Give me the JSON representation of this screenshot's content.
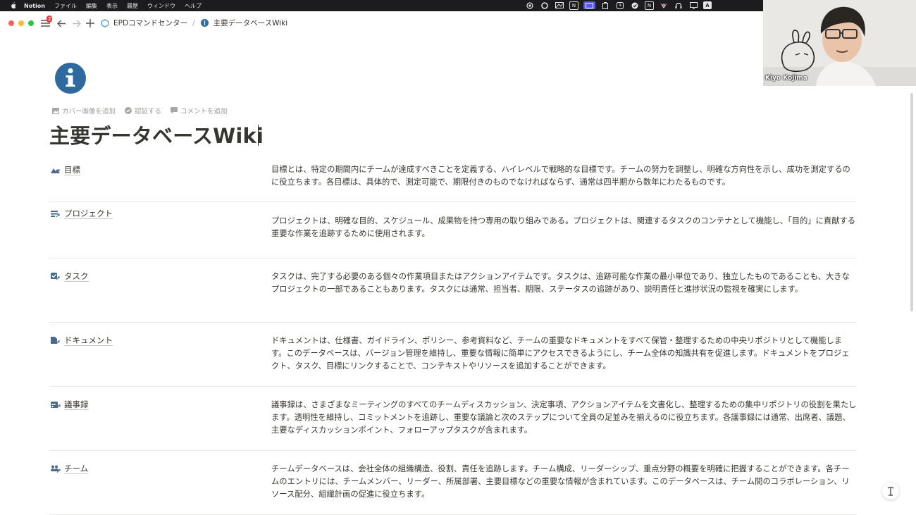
{
  "menubar": {
    "items": [
      "Notion",
      "ファイル",
      "編集",
      "表示",
      "履歴",
      "ウィンドウ",
      "ヘルプ"
    ],
    "tray_letters": {
      "n1": "N",
      "n2": "N",
      "a": "A"
    }
  },
  "topbar": {
    "badge": "2",
    "breadcrumb": [
      "EPDコマンドセンター",
      "主要データベースWiki"
    ],
    "separator": "/"
  },
  "webcam": {
    "name": "Kiyo Kojima"
  },
  "page": {
    "actions": {
      "cover": "カバー画像を追加",
      "verify": "認証する",
      "comment": "コメントを追加"
    },
    "title": "主要データベースWiki"
  },
  "rows": [
    {
      "name": "目標",
      "icon": "goal-icon",
      "desc": "目標とは、特定の期間内にチームが達成すべきことを定義する、ハイレベルで戦略的な目標です。チームの努力を調整し、明確な方向性を示し、成功を測定するのに役立ちます。各目標は、具体的で、測定可能で、期限付きのものでなければならず、通常は四半期から数年にわたるものです。"
    },
    {
      "name": "プロジェクト",
      "icon": "project-icon",
      "desc": "プロジェクトは、明確な目的、スケジュール、成果物を持つ専用の取り組みである。プロジェクトは、関連するタスクのコンテナとして機能し、「目的」に貢献する重要な作業を追跡するために使用されます。"
    },
    {
      "name": "タスク",
      "icon": "task-icon",
      "desc": "タスクは、完了する必要のある個々の作業項目またはアクションアイテムです。タスクは、追跡可能な作業の最小単位であり、独立したものであることも、大きなプロジェクトの一部であることもあります。タスクには通常、担当者、期限、ステータスの追跡があり、説明責任と進捗状況の監視を確実にします。"
    },
    {
      "name": "ドキュメント",
      "icon": "document-icon",
      "desc": "ドキュメントは、仕様書、ガイドライン、ポリシー、参考資料など、チームの重要なドキュメントをすべて保管・整理するための中央リポジトリとして機能します。このデータベースは、バージョン管理を維持し、重要な情報に簡単にアクセスできるようにし、チーム全体の知識共有を促進します。ドキュメントをプロジェクト、タスク、目標にリンクすることで、コンテキストやリソースを追加することができます。"
    },
    {
      "name": "議事録",
      "icon": "meeting-notes-icon",
      "desc": "議事録は、さまざまなミーティングのすべてのチームディスカッション、決定事項、アクションアイテムを文書化し、整理するための集中リポジトリの役割を果たします。透明性を維持し、コミットメントを追跡し、重要な議論と次のステップについて全員の足並みを揃えるのに役立ちます。各議事録には通常、出席者、議題、主要なディスカッションポイント、フォローアップタスクが含まれます。"
    },
    {
      "name": "チーム",
      "icon": "team-icon",
      "desc": "チームデータベースは、会社全体の組織構造、役割、責任を追跡します。チーム構成、リーダーシップ、重点分野の概要を明確に把握することができます。各チームのエントリには、チームメンバー、リーダー、所属部署、主要目標などの重要な情報が含まれています。このデータベースは、チーム間のコラボレーション、リソース配分、組織計画の促進に役立ちます。"
    }
  ],
  "help": {
    "label": "?"
  }
}
